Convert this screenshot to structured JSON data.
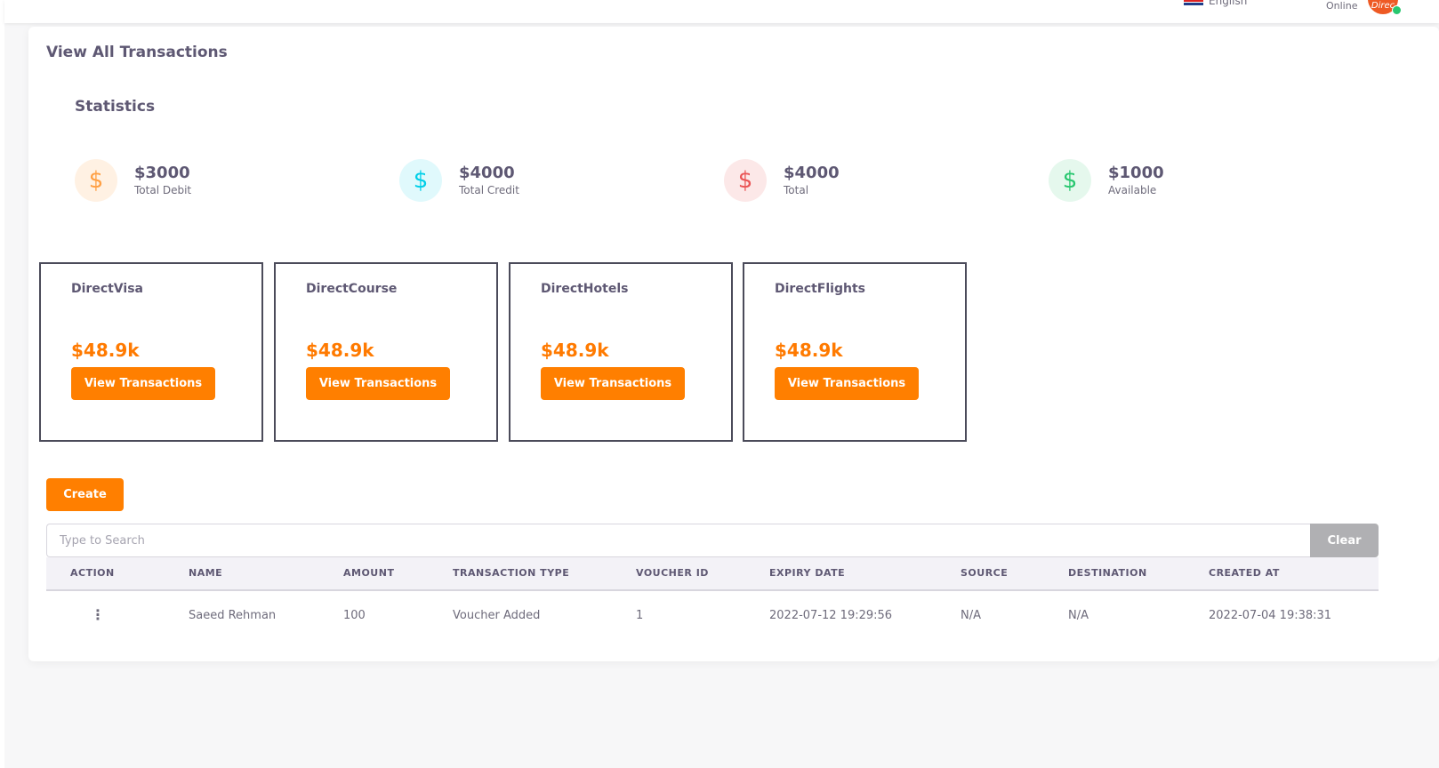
{
  "header": {
    "language": "English",
    "status": "Online",
    "avatar_text": "Direc"
  },
  "page": {
    "title": "View All Transactions"
  },
  "statistics": {
    "title": "Statistics",
    "items": [
      {
        "icon": "dollar-icon",
        "symbol": "$",
        "value": "$3000",
        "label": "Total Debit",
        "color": "#ff9f43",
        "bg": "#fff1e3"
      },
      {
        "icon": "dollar-icon",
        "symbol": "$",
        "value": "$4000",
        "label": "Total Credit",
        "color": "#00cfe8",
        "bg": "#e0f9fc"
      },
      {
        "icon": "dollar-icon",
        "symbol": "$",
        "value": "$4000",
        "label": "Total",
        "color": "#ea5455",
        "bg": "#fce8e8"
      },
      {
        "icon": "dollar-icon",
        "symbol": "$",
        "value": "$1000",
        "label": "Available",
        "color": "#28c76f",
        "bg": "#e5f8ed"
      }
    ]
  },
  "services": [
    {
      "name": "DirectVisa",
      "amount": "$48.9k",
      "button": "View Transactions"
    },
    {
      "name": "DirectCourse",
      "amount": "$48.9k",
      "button": "View Transactions"
    },
    {
      "name": "DirectHotels",
      "amount": "$48.9k",
      "button": "View Transactions"
    },
    {
      "name": "DirectFlights",
      "amount": "$48.9k",
      "button": "View Transactions"
    }
  ],
  "actions": {
    "create_label": "Create"
  },
  "search": {
    "placeholder": "Type to Search",
    "value": "",
    "clear_label": "Clear"
  },
  "table": {
    "columns": [
      "ACTION",
      "NAME",
      "AMOUNT",
      "TRANSACTION TYPE",
      "VOUCHER ID",
      "EXPIRY DATE",
      "SOURCE",
      "DESTINATION",
      "CREATED AT"
    ],
    "rows": [
      {
        "action": "⋮",
        "name": "Saeed Rehman",
        "amount": "100",
        "transaction_type": "Voucher Added",
        "voucher_id": "1",
        "expiry_date": "2022-07-12 19:29:56",
        "source": "N/A",
        "destination": "N/A",
        "created_at": "2022-07-04 19:38:31"
      }
    ]
  },
  "colors": {
    "accent": "#ff7f00",
    "clear_button": "#b0b0b3"
  }
}
